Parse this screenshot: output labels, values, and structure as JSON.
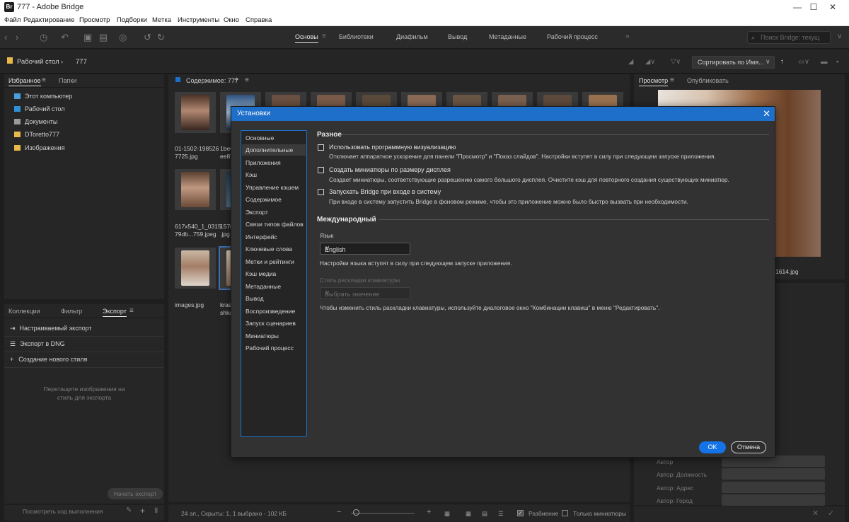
{
  "window": {
    "title": "777 - Adobe Bridge",
    "logo": "Br"
  },
  "menu": [
    "Файл",
    "Редактирование",
    "Просмотр",
    "Подборки",
    "Метка",
    "Инструменты",
    "Окно",
    "Справка"
  ],
  "workspaces": [
    {
      "label": "Основы",
      "active": true
    },
    {
      "label": "Библиотеки"
    },
    {
      "label": "Диафильм"
    },
    {
      "label": "Вывод"
    },
    {
      "label": "Метаданные"
    },
    {
      "label": "Рабочий процесс"
    }
  ],
  "search": {
    "placeholder": "Поиск Bridge: текущ"
  },
  "path": {
    "root": "Рабочий стол",
    "current": "777"
  },
  "sort": {
    "label": "Сортировать по Имя..."
  },
  "left_panel": {
    "tabs": [
      "Избранное",
      "Папки"
    ],
    "favorites": [
      "Этот компьютер",
      "Рабочий стол",
      "Документы",
      "DToretto777",
      "Изображения"
    ],
    "bottom_tabs": [
      "Коллекции",
      "Фильтр",
      "Экспорт"
    ],
    "export_items": [
      "Настраиваемый экспорт",
      "Экспорт в DNG",
      "Создание нового стиля"
    ],
    "drop_hint_1": "Перетащите изображения на",
    "drop_hint_2": "стиль для экспорта",
    "start_export": "Начать экспорт",
    "progress": "Посмотреть ход выполнения"
  },
  "content": {
    "title": "Содержимое: 777",
    "captions": [
      [
        "01-1502-198526",
        "7725.jpg"
      ],
      [
        "1be0",
        "ee87"
      ],
      [
        "617x540_1_0315",
        "79db...759.jpeg"
      ],
      [
        "1570",
        ".jpg"
      ],
      [
        "images.jpg",
        ""
      ],
      [
        "kras",
        "shka"
      ]
    ]
  },
  "status": {
    "text": "24 эл., Скрыты: 1, 1 выбрано - 102 КБ",
    "split": "Разбиение",
    "only_thumbs": "Только миниатюры"
  },
  "right_panel": {
    "tabs": [
      "Просмотр",
      "Опубликовать"
    ],
    "file_suffix": "1614.jpg",
    "meta_labels": [
      "Автор",
      "Автор: Должность",
      "Автор: Адрес",
      "Автор: Город"
    ]
  },
  "dialog": {
    "title": "Установки",
    "categories": [
      "Основные",
      "Дополнительные",
      "Приложения",
      "Кэш",
      "Управление кэшем",
      "Содержимое",
      "Экспорт",
      "Связи типов файлов",
      "Интерфейс",
      "Ключевые слова",
      "Метки и рейтинги",
      "Кэш медиа",
      "Метаданные",
      "Вывод",
      "Воспроизведение",
      "Запуск сценариев",
      "Миниатюры",
      "Рабочий процесс"
    ],
    "section_misc": "Разное",
    "options": [
      {
        "label": "Использовать программную визуализацию",
        "desc": "Отключает аппаратное ускорение для панели \"Просмотр\" и \"Показ слайдов\". Настройки вступят в силу при следующем запуске приложения.",
        "checked": false
      },
      {
        "label": "Создать миниатюры по размеру дисплея",
        "desc": "Создает миниатюры, соответствующие разрешению самого большого дисплея.  Очистите кэш для повторного создания существующих миниатюр.",
        "checked": false
      },
      {
        "label": "Запускать Bridge при входе в систему",
        "desc": "При входе в систему запустить Bridge в фоновом режиме, чтобы это приложение можно было быстро вызвать при необходимости.",
        "checked": false
      }
    ],
    "section_intl": "Международный",
    "language_label": "Язык",
    "language_value": "English",
    "language_note": "Настройки языка вступят в силу при следующем запуске приложения.",
    "keyboard_label": "Стиль раскладки клавиатуры",
    "keyboard_value": "Выбрать значение",
    "keyboard_note": "Чтобы изменить стиль раскладки клавиатуры, используйте диалоговое окно \"Комбинации клавиш\" в меню \"Редактировать\".",
    "ok": "OK",
    "cancel": "Отмена"
  }
}
